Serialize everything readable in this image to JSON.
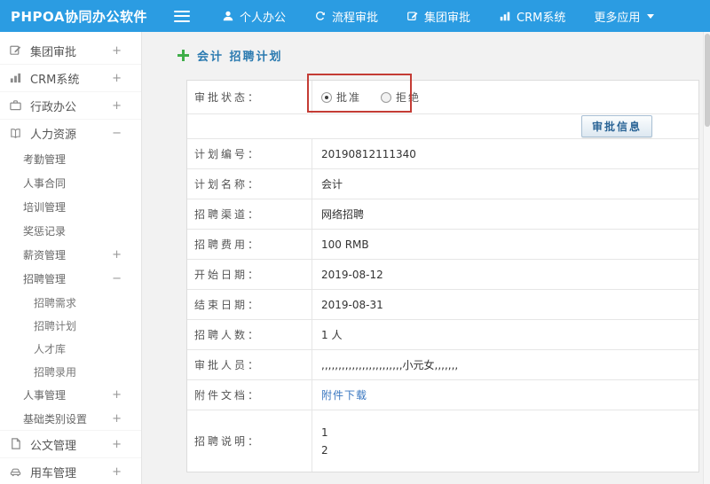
{
  "topbar": {
    "title": "PHPOA协同办公软件",
    "menu_icon": "hamburger-icon",
    "color": "#2b9ce2",
    "nav": [
      {
        "label": "个人办公",
        "icon": "person-icon"
      },
      {
        "label": "流程审批",
        "icon": "workflow-icon"
      },
      {
        "label": "集团审批",
        "icon": "edit-icon"
      },
      {
        "label": "CRM系统",
        "icon": "bar-chart-icon"
      },
      {
        "label": "更多应用",
        "icon": "caret-down-icon"
      }
    ]
  },
  "sidebar": {
    "items": [
      {
        "label": "集团审批",
        "toggle": "+",
        "icon": "edit-icon",
        "level": 0
      },
      {
        "label": "CRM系统",
        "toggle": "+",
        "icon": "bar-chart-icon",
        "level": 0
      },
      {
        "label": "行政办公",
        "toggle": "+",
        "icon": "briefcase-icon",
        "level": 0
      },
      {
        "label": "人力资源",
        "toggle": "−",
        "icon": "book-icon",
        "level": 0
      },
      {
        "label": "考勤管理",
        "level": 1
      },
      {
        "label": "人事合同",
        "level": 1
      },
      {
        "label": "培训管理",
        "level": 1
      },
      {
        "label": "奖惩记录",
        "level": 1
      },
      {
        "label": "薪资管理",
        "toggle": "+",
        "level": 1
      },
      {
        "label": "招聘管理",
        "toggle": "−",
        "level": 1
      },
      {
        "label": "招聘需求",
        "level": 2
      },
      {
        "label": "招聘计划",
        "level": 2
      },
      {
        "label": "人才库",
        "level": 2
      },
      {
        "label": "招聘录用",
        "level": 2
      },
      {
        "label": "人事管理",
        "toggle": "+",
        "level": 1
      },
      {
        "label": "基础类别设置",
        "toggle": "+",
        "level": 1
      },
      {
        "label": "公文管理",
        "toggle": "+",
        "icon": "document-icon",
        "level": 0
      },
      {
        "label": "用车管理",
        "toggle": "+",
        "icon": "car-icon",
        "level": 0
      }
    ]
  },
  "content": {
    "breadcrumb": {
      "icon": "add-icon",
      "title": "会计 招聘计划"
    },
    "annotation_color": "#c43c35",
    "form": {
      "status": {
        "label": "审批状态：",
        "options": [
          {
            "label": "批准",
            "checked": true
          },
          {
            "label": "拒绝",
            "checked": false
          }
        ]
      },
      "button_label": "审批信息",
      "rows": [
        {
          "label": "计划编号：",
          "value": "20190812111340"
        },
        {
          "label": "计划名称：",
          "value": "会计"
        },
        {
          "label": "招聘渠道：",
          "value": "网络招聘"
        },
        {
          "label": "招聘费用：",
          "value": "100 RMB"
        },
        {
          "label": "开始日期：",
          "value": "2019-08-12"
        },
        {
          "label": "结束日期：",
          "value": "2019-08-31"
        },
        {
          "label": "招聘人数：",
          "value": "1 人"
        },
        {
          "label": "审批人员：",
          "value": ",,,,,,,,,,,,,,,,,,,,,,,,小元女,,,,,,,"
        },
        {
          "label": "附件文档：",
          "value": "附件下载",
          "type": "link",
          "link_color": "#3a77c0"
        },
        {
          "label": "招聘说明：",
          "lines": [
            "1",
            "2"
          ]
        }
      ]
    }
  }
}
